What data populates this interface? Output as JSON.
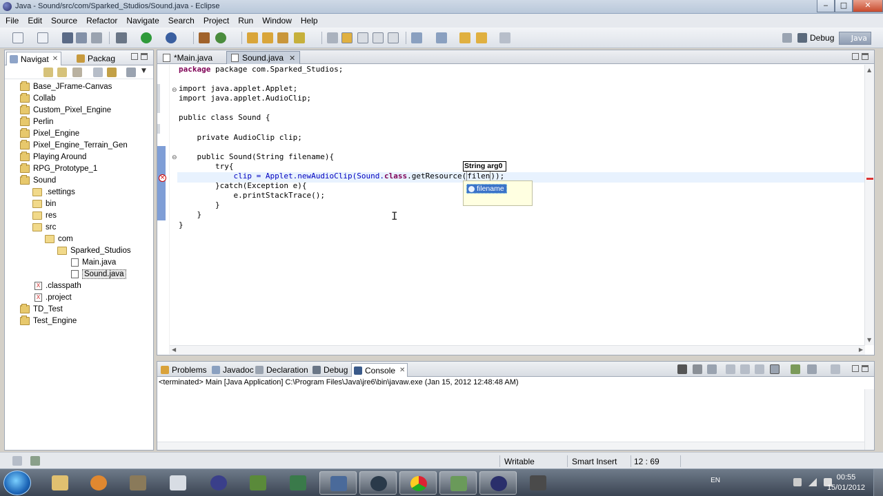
{
  "window": {
    "title": "Java - Sound/src/com/Sparked_Studios/Sound.java - Eclipse",
    "buttons": {
      "minimize": "‒",
      "maximize": "□",
      "close": "✕"
    }
  },
  "menu": [
    "File",
    "Edit",
    "Source",
    "Refactor",
    "Navigate",
    "Search",
    "Project",
    "Run",
    "Window",
    "Help"
  ],
  "toolbar": {
    "perspectives": {
      "debug": "Debug",
      "java": "Java"
    }
  },
  "left_panel": {
    "tabs": [
      {
        "label": "Navigat",
        "active": true
      },
      {
        "label": "Packag",
        "active": false
      }
    ],
    "tree": [
      {
        "label": "Base_JFrame-Canvas",
        "type": "project",
        "depth": 0
      },
      {
        "label": "Collab",
        "type": "project",
        "depth": 0
      },
      {
        "label": "Custom_Pixel_Engine",
        "type": "project",
        "depth": 0
      },
      {
        "label": "Perlin",
        "type": "project",
        "depth": 0
      },
      {
        "label": "Pixel_Engine",
        "type": "project",
        "depth": 0
      },
      {
        "label": "Pixel_Engine_Terrain_Gen",
        "type": "project",
        "depth": 0
      },
      {
        "label": "Playing Around",
        "type": "project",
        "depth": 0
      },
      {
        "label": "RPG_Prototype_1",
        "type": "project",
        "depth": 0
      },
      {
        "label": "Sound",
        "type": "project",
        "depth": 0
      },
      {
        "label": ".settings",
        "type": "folder",
        "depth": 1
      },
      {
        "label": "bin",
        "type": "folder",
        "depth": 1
      },
      {
        "label": "res",
        "type": "folder",
        "depth": 1
      },
      {
        "label": "src",
        "type": "folder",
        "depth": 1
      },
      {
        "label": "com",
        "type": "folder",
        "depth": 2
      },
      {
        "label": "Sparked_Studios",
        "type": "folder",
        "depth": 3
      },
      {
        "label": "Main.java",
        "type": "file",
        "depth": 4
      },
      {
        "label": "Sound.java",
        "type": "file",
        "depth": 4,
        "selected": true
      },
      {
        "label": ".classpath",
        "type": "xfile",
        "depth": 1
      },
      {
        "label": ".project",
        "type": "xfile",
        "depth": 1
      },
      {
        "label": "TD_Test",
        "type": "project",
        "depth": 0
      },
      {
        "label": "Test_Engine",
        "type": "project",
        "depth": 0
      }
    ]
  },
  "editor": {
    "tabs": [
      {
        "label": "*Main.java",
        "active": false
      },
      {
        "label": "Sound.java",
        "active": true
      }
    ],
    "code": {
      "l1": "package com.Sparked_Studios;",
      "l3": "import java.applet.Applet;",
      "l4": "import java.applet.AudioClip;",
      "l6": "public class Sound {",
      "l8": "private AudioClip clip;",
      "l10": "public Sound(String filename){",
      "l11": "try{",
      "l12a": "clip = Applet.newAudioClip(Sound.",
      "l12b": "class",
      "l12c": ".getResource(",
      "l12d": "filen",
      "l12e": "));",
      "l13": "}catch(Exception e){",
      "l14": "e.printStackTrace();",
      "l15": "}",
      "l16": "}",
      "l17": "}"
    },
    "param_hint": "String arg0",
    "assist_item": "filename"
  },
  "bottom_panel": {
    "tabs": [
      {
        "label": "Problems",
        "active": false
      },
      {
        "label": "Javadoc",
        "active": false
      },
      {
        "label": "Declaration",
        "active": false
      },
      {
        "label": "Debug",
        "active": false
      },
      {
        "label": "Console",
        "active": true
      }
    ],
    "console_header": "<terminated> Main [Java Application] C:\\Program Files\\Java\\jre6\\bin\\javaw.exe (Jan 15, 2012 12:48:48 AM)"
  },
  "status_bar": {
    "mode": "Writable",
    "insert": "Smart Insert",
    "position": "12 : 69"
  },
  "taskbar": {
    "lang": "EN",
    "time": "00:55",
    "date": "15/01/2012"
  }
}
